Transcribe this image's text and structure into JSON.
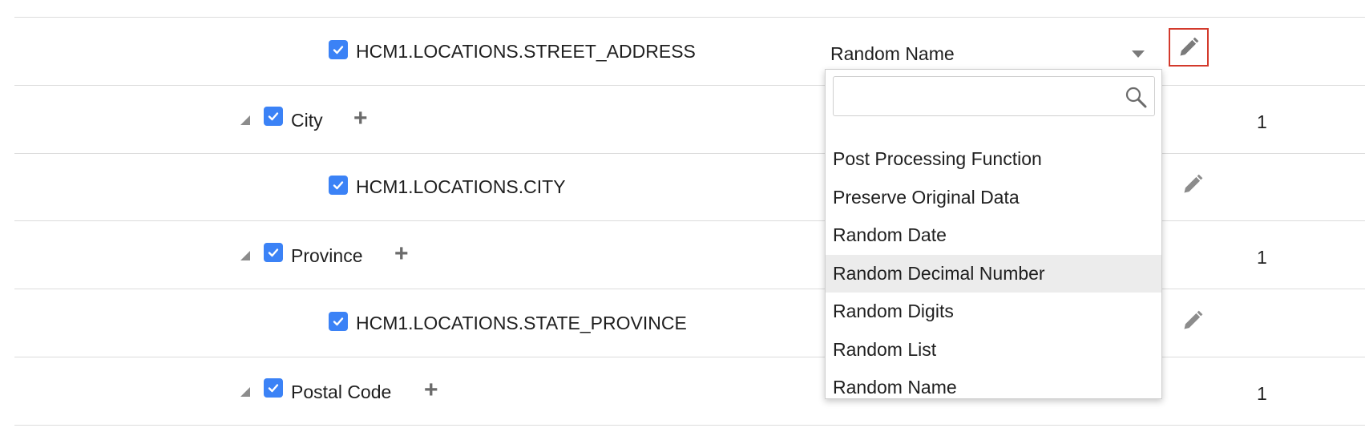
{
  "rows": [
    {
      "type": "field",
      "label": "HCM1.LOCATIONS.STREET_ADDRESS"
    },
    {
      "type": "group",
      "label": "City",
      "count": "1"
    },
    {
      "type": "field",
      "label": "HCM1.LOCATIONS.CITY"
    },
    {
      "type": "group",
      "label": "Province",
      "count": "1"
    },
    {
      "type": "field",
      "label": "HCM1.LOCATIONS.STATE_PROVINCE"
    },
    {
      "type": "group",
      "label": "Postal Code",
      "count": "1"
    }
  ],
  "icons": {
    "expander": "triangle-expanded-icon",
    "checkbox": "checkmark-icon",
    "add": "plus-icon",
    "edit": "pencil-icon",
    "search": "magnifier-icon",
    "dropdown": "chevron-down-icon"
  },
  "plus_symbol": "+",
  "select": {
    "value": "Random Name"
  },
  "dropdown": {
    "search_value": "",
    "search_placeholder": "",
    "highlighted_option": "Random Decimal Number",
    "options": [
      "Post Processing Function",
      "Preserve Original Data",
      "Random Date",
      "Random Decimal Number",
      "Random Digits",
      "Random List",
      "Random Name"
    ]
  },
  "colors": {
    "checkbox": "#3b82f6",
    "active_edit_border": "#d33a2c",
    "highlight": "#ececec"
  }
}
